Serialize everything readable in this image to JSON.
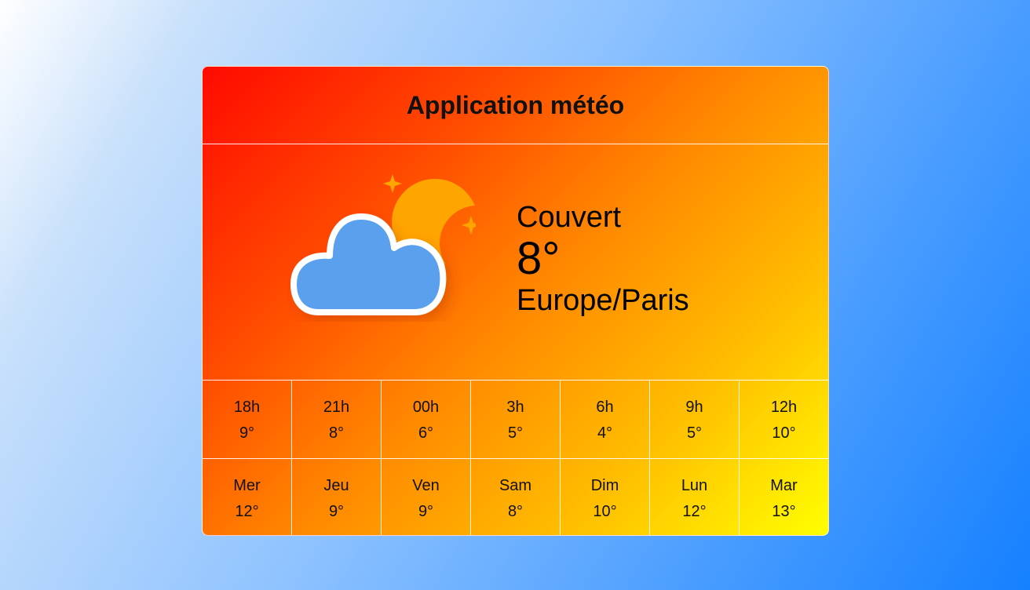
{
  "app": {
    "title": "Application météo"
  },
  "current": {
    "condition": "Couvert",
    "temperature": "8°",
    "location": "Europe/Paris",
    "icon": "cloud-moon-icon",
    "colors": {
      "cloud": "#5aa0ec",
      "moon": "#ffa500"
    }
  },
  "hourly": [
    {
      "label": "18h",
      "value": "9°"
    },
    {
      "label": "21h",
      "value": "8°"
    },
    {
      "label": "00h",
      "value": "6°"
    },
    {
      "label": "3h",
      "value": "5°"
    },
    {
      "label": "6h",
      "value": "4°"
    },
    {
      "label": "9h",
      "value": "5°"
    },
    {
      "label": "12h",
      "value": "10°"
    }
  ],
  "daily": [
    {
      "label": "Mer",
      "value": "12°"
    },
    {
      "label": "Jeu",
      "value": "9°"
    },
    {
      "label": "Ven",
      "value": "9°"
    },
    {
      "label": "Sam",
      "value": "8°"
    },
    {
      "label": "Dim",
      "value": "10°"
    },
    {
      "label": "Lun",
      "value": "12°"
    },
    {
      "label": "Mar",
      "value": "13°"
    }
  ]
}
